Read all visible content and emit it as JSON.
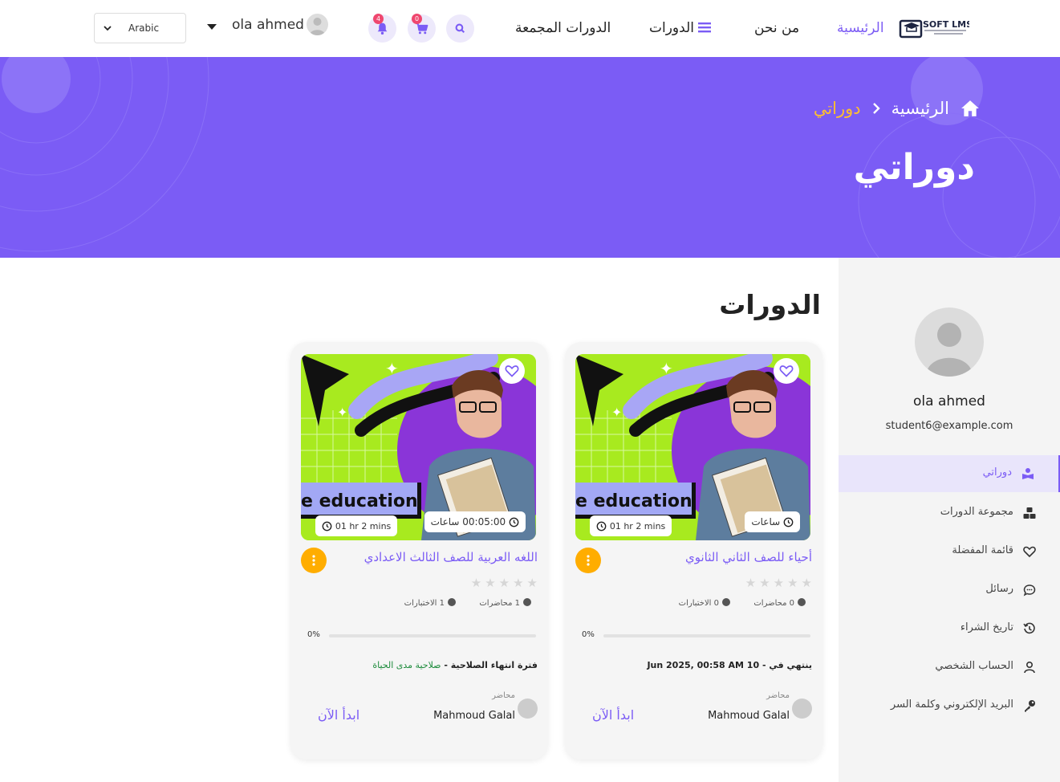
{
  "header": {
    "language": "Arabic",
    "user_name": "ola ahmed",
    "notif_count": "4",
    "cart_count": "0",
    "nav": {
      "home": "الرئيسية",
      "about": "من نحن",
      "courses": "الدورات",
      "bundles": "الدورات المجمعة"
    },
    "logo_text": "SOFT LMS"
  },
  "hero": {
    "crumb_home": "الرئيسية",
    "crumb_current": "دوراتي",
    "title": "دوراتي"
  },
  "sidebar": {
    "name": "ola ahmed",
    "email": "student6@example.com",
    "items": [
      {
        "label": "دوراتي",
        "icon": "book-reader-icon"
      },
      {
        "label": "مجموعة الدورات",
        "icon": "cubes-icon"
      },
      {
        "label": "قائمة المفضلة",
        "icon": "heart-icon"
      },
      {
        "label": "رسائل",
        "icon": "chat-icon"
      },
      {
        "label": "تاريخ الشراء",
        "icon": "history-icon"
      },
      {
        "label": "الحساب الشخصي",
        "icon": "user-icon"
      },
      {
        "label": "البريد الإلكتروني وكلمة السر",
        "icon": "key-icon"
      }
    ]
  },
  "main": {
    "section_title": "الدورات",
    "cards": [
      {
        "title": "أحياء للصف الثاني الثانوي",
        "thumb_text": "e education",
        "duration_hours": "ساعات",
        "duration_time": "",
        "duration_short": "01 hr 2 mins",
        "lectures": "0 محاضرات",
        "quizzes": "0 الاختبارات",
        "progress_label": "0%",
        "progress": 0,
        "expiry_label": "ينتهي في - ",
        "expiry_value": "10 Jun 2025, 00:58 AM",
        "instructor_role": "محاضر",
        "instructor_name": "Mahmoud Galal",
        "start_label": "ابدأ الآن"
      },
      {
        "title": "اللغه العربية للصف الثالث الاعدادي",
        "thumb_text": "e education",
        "duration_hours": "ساعات",
        "duration_time": "00:05:00",
        "duration_short": "01 hr 2 mins",
        "lectures": "1 محاضرات",
        "quizzes": "1 الاختبارات",
        "progress_label": "0%",
        "progress": 0,
        "expiry_label": "فترة انتهاء الصلاحية - ",
        "expiry_value": "صلاحية مدى الحياة",
        "instructor_role": "محاضر",
        "instructor_name": "Mahmoud Galal",
        "start_label": "ابدأ الآن"
      }
    ]
  },
  "colors": {
    "accent": "#7b5cf5",
    "breadcrumb_current": "#ffbf2f",
    "menu_dot": "#ffad00",
    "lifetime_green": "#1c8b3b"
  }
}
